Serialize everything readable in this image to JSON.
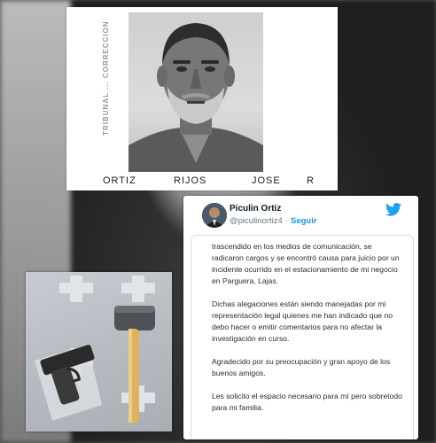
{
  "mugshot": {
    "labels": [
      "ORTIZ",
      "RIJOS",
      "JOSE",
      "R"
    ],
    "stamp_text": "TRIBUNAL ... CORRECCION",
    "stamp_color": "#6a6a6a"
  },
  "tweet": {
    "display_name": "Piculin Ortiz",
    "handle": "@piculinortiz4",
    "separator": "·",
    "follow_label": "Seguir",
    "brand_color": "#1da1f2",
    "follow_color": "#1b95e0",
    "platform_icon": "twitter-bird-icon",
    "paragraphs": [
      "trascendido en los medios de comunicación, se radicaron cargos y se encontró causa para juicio por un incidente ocurrido en el estacionamiento de mi negocio en Parguera, Lajas.",
      "Dichas alegaciones están siendo manejadas por mi representación legal quienes me han indicado que no debo hacer o emitir comentarios para no afectar la investigación en curso.",
      "Agradecido por su preocupación y gran apoyo de los buenos amigos.",
      "Les solicito el espacio necesario para mí pero sobretodo para mi familia."
    ]
  },
  "evidence": {
    "items": [
      "handgun-in-evidence-bag",
      "sledgehammer"
    ]
  }
}
